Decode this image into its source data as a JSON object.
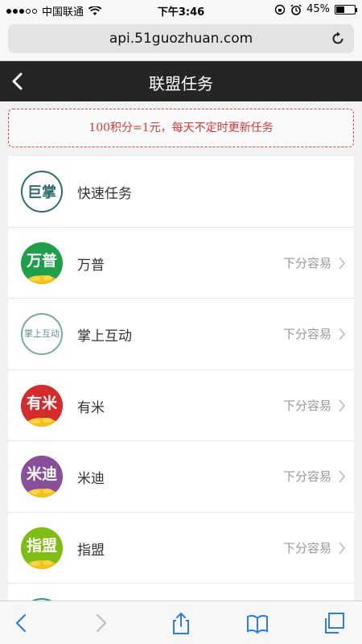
{
  "status": {
    "carrier": "中国联通",
    "time": "下午3:46",
    "battery": "45%",
    "battery_level": 0.45
  },
  "browser": {
    "url": "api.51guozhuan.com"
  },
  "nav": {
    "title": "联盟任务"
  },
  "notice": "100积分=1元，每天不定时更新任务",
  "tasks": [
    {
      "name": "快速任务",
      "hint": "",
      "logo_text": "巨掌",
      "logo_color": "#ffffff",
      "logo_accent": "#2f6b69"
    },
    {
      "name": "万普",
      "hint": "下分容易",
      "logo_text": "万普",
      "logo_color": "#1f9f4a"
    },
    {
      "name": "掌上互动",
      "hint": "下分容易",
      "logo_text": "掌上互动",
      "logo_color": "#ffffff",
      "logo_accent": "#7aa9a5"
    },
    {
      "name": "有米",
      "hint": "下分容易",
      "logo_text": "有米",
      "logo_color": "#d52b2b"
    },
    {
      "name": "米迪",
      "hint": "下分容易",
      "logo_text": "米迪",
      "logo_color": "#8a4f9b"
    },
    {
      "name": "指盟",
      "hint": "下分容易",
      "logo_text": "指盟",
      "logo_color": "#7fbd12"
    }
  ],
  "colors": {
    "nav_bg": "#252525",
    "notice_red": "#d8383a",
    "ios_blue": "#2f7de1"
  },
  "icons": {
    "back": "chevron-left-icon",
    "reload": "reload-icon",
    "chevron": "chevron-right-icon",
    "share": "share-icon",
    "bookmarks": "bookmarks-icon",
    "tabs": "tabs-icon"
  }
}
